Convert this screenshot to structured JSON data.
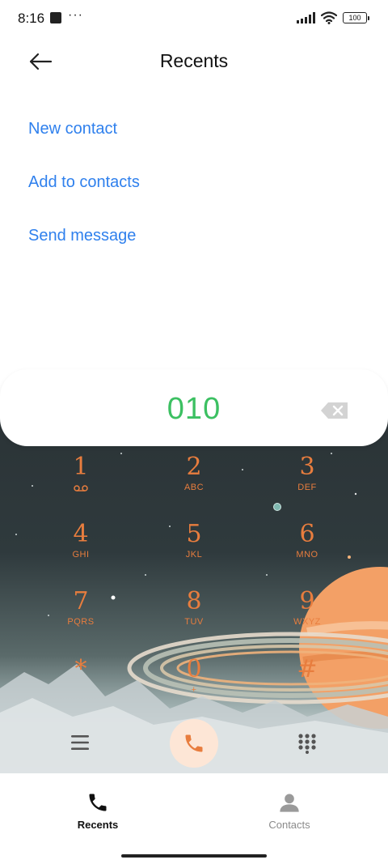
{
  "status_bar": {
    "time": "8:16",
    "more": "···",
    "battery": "100"
  },
  "header": {
    "title": "Recents",
    "back_icon": "arrow-left-icon"
  },
  "options": [
    {
      "label": "New contact"
    },
    {
      "label": "Add to contacts"
    },
    {
      "label": "Send message"
    }
  ],
  "dialer": {
    "number": "010",
    "backspace_icon": "backspace-icon",
    "keys": [
      {
        "digit": "1",
        "letters": ""
      },
      {
        "digit": "2",
        "letters": "ABC"
      },
      {
        "digit": "3",
        "letters": "DEF"
      },
      {
        "digit": "4",
        "letters": "GHI"
      },
      {
        "digit": "5",
        "letters": "JKL"
      },
      {
        "digit": "6",
        "letters": "MNO"
      },
      {
        "digit": "7",
        "letters": "PQRS"
      },
      {
        "digit": "8",
        "letters": "TUV"
      },
      {
        "digit": "9",
        "letters": "WXYZ"
      },
      {
        "digit": "*",
        "letters": ""
      },
      {
        "digit": "0",
        "letters": "+"
      },
      {
        "digit": "#",
        "letters": ""
      }
    ]
  },
  "bottom_nav": {
    "items": [
      {
        "label": "Recents",
        "icon": "phone-icon"
      },
      {
        "label": "Contacts",
        "icon": "person-icon"
      }
    ]
  },
  "colors": {
    "accent_blue": "#2f80ed",
    "number_green": "#3cc062",
    "key_orange": "#e87d3e",
    "call_bg": "#fde6d6"
  }
}
